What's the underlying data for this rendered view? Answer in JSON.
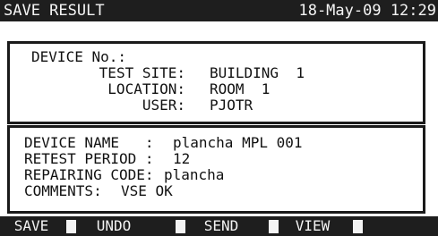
{
  "header": {
    "title": "SAVE RESULT",
    "datetime": "18-May-09 12:29"
  },
  "location_block": {
    "rows": [
      {
        "label": "DEVICE No.:",
        "value": ""
      },
      {
        "label": "TEST SITE:",
        "value": "BUILDING  1"
      },
      {
        "label": "LOCATION:",
        "value": "ROOM  1"
      },
      {
        "label": "USER:",
        "value": "PJOTR"
      }
    ]
  },
  "device_block": {
    "rows": [
      {
        "label": "DEVICE NAME   :",
        "value": "plancha MPL 001"
      },
      {
        "label": "RETEST PERIOD :",
        "value": "12"
      },
      {
        "label": "REPAIRING CODE:",
        "value": "plancha"
      },
      {
        "label": "COMMENTS:",
        "value": "VSE OK"
      }
    ]
  },
  "function_keys": [
    {
      "label": "SAVE"
    },
    {
      "label": "UNDO"
    },
    {
      "label": "SEND"
    },
    {
      "label": "VIEW"
    }
  ],
  "colors": {
    "background": "#ffffff",
    "bar": "#1e1e1e",
    "bar_text": "#f4f4f4"
  }
}
